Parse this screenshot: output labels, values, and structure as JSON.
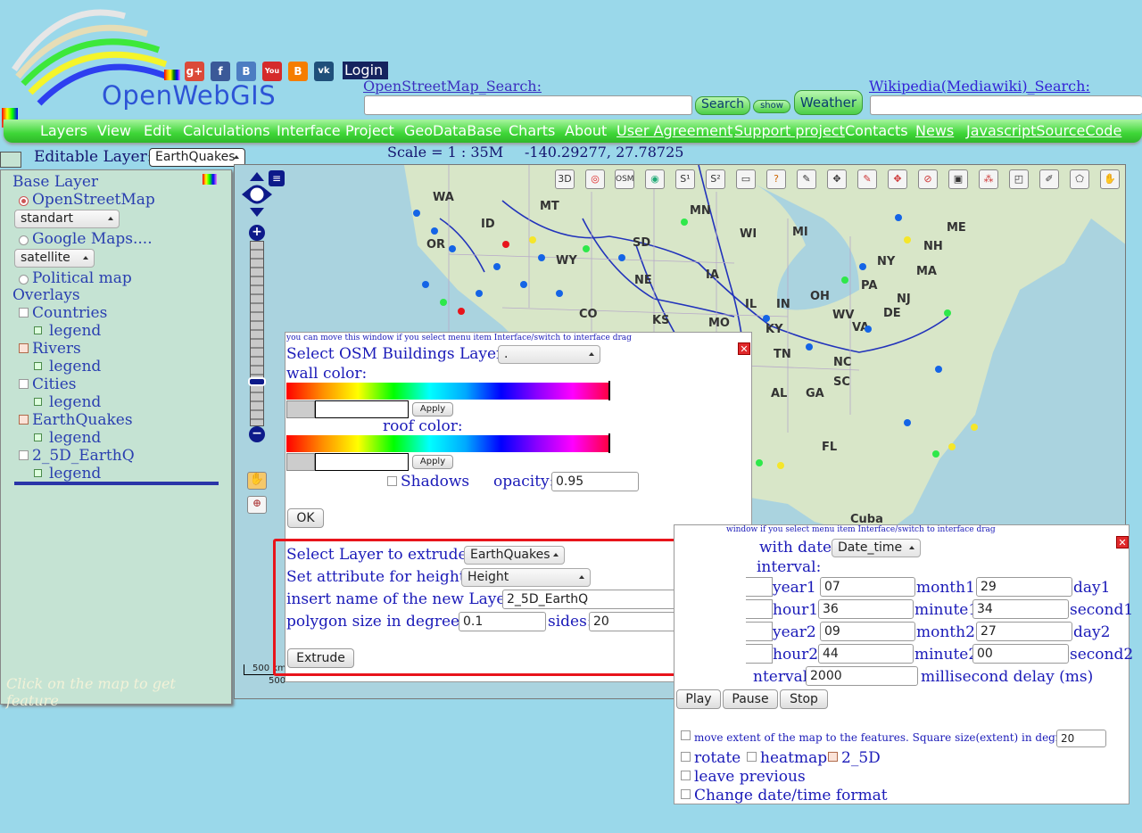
{
  "header": {
    "logo_text": "OpenWebGIS",
    "social_icons": [
      "rainbow-icon",
      "google-plus-icon",
      "facebook-icon",
      "b-icon",
      "youtube-icon",
      "blogger-icon",
      "vk-icon"
    ],
    "social_letters": {
      "google": "g+",
      "facebook": "f",
      "b": "B",
      "youtube": "You",
      "blogger": "B",
      "vk": "vk"
    },
    "login_label": "Login",
    "osm_search_label": "OpenStreetMap_Search:",
    "osm_search_value": "",
    "search_button": "Search",
    "show_button": "show",
    "weather_button": "Weather",
    "wiki_search_label": "Wikipedia(Mediawiki)_Search:"
  },
  "menu": {
    "items": [
      "Layers",
      "View",
      "Edit",
      "Calculations",
      "Interface",
      "Project",
      "GeoDataBase",
      "Charts",
      "About",
      "User Agreement",
      "Support project",
      "Contacts",
      "News",
      "JavascriptSourceCode"
    ]
  },
  "editable_layer": {
    "label": "Editable Layer:",
    "value": "EarthQuakes"
  },
  "scale": {
    "text": "Scale = 1 : 35M",
    "coords": "-140.29277, 27.78725"
  },
  "layers_panel": {
    "base_layer": "Base Layer",
    "osm": "OpenStreetMap",
    "osm_style": "standart",
    "google": "Google Maps....",
    "google_style": "satellite",
    "political": "Political map",
    "overlays": "Overlays",
    "overlay_items": [
      {
        "name": "Countries",
        "checked": false
      },
      {
        "name": "Rivers",
        "checked": true
      },
      {
        "name": "Cities",
        "checked": false
      },
      {
        "name": "EarthQuakes",
        "checked": true
      },
      {
        "name": "2_5D_EarthQ",
        "checked": false
      }
    ],
    "legend": "legend",
    "feature_hint": "Click on the map to get feature"
  },
  "map": {
    "labels": [
      "WA",
      "MT",
      "MN",
      "ID",
      "OR",
      "SD",
      "WI",
      "MI",
      "ME",
      "NY",
      "NH",
      "MA",
      "WY",
      "NE",
      "IA",
      "PA",
      "NJ",
      "CO",
      "KS",
      "MO",
      "IL",
      "IN",
      "OH",
      "WV",
      "DE",
      "VA",
      "KY",
      "TN",
      "NC",
      "SC",
      "AL",
      "GA",
      "FL",
      "Cuba"
    ],
    "scale_bar": "500 km",
    "scale_bar2": "500"
  },
  "osm_dialog": {
    "hint": "you can move this window if you select menu item Interface/switch to interface drag",
    "select_label": "Select OSM Buildings Layer:",
    "select_value": ".",
    "wall_color": "wall color:",
    "roof_color": "roof color:",
    "apply": "Apply",
    "shadows": "Shadows",
    "opacity_label": "opacity:",
    "opacity_value": "0.95",
    "ok": "OK",
    "extrude_layer_label": "Select Layer to extrude:",
    "extrude_layer_value": "EarthQuakes",
    "height_label": "Set attribute for height:",
    "height_value": "Height",
    "new_layer_label": "insert name of the new Layer:",
    "new_layer_value": "2_5D_EarthQ",
    "polygon_label": "polygon size in degrees:",
    "polygon_value": "0.1",
    "sides_label": "sides:",
    "sides_value": "20",
    "extrude_button": "Extrude"
  },
  "time_dialog": {
    "hint": "window if you select menu item Interface/switch to interface drag",
    "with_date": "with date:",
    "date_field": "Date_time",
    "interval": "interval:",
    "year1": "year1",
    "year1_val": "07",
    "month1": "month1",
    "month1_val": "29",
    "day1": "day1",
    "hour1": "hour1",
    "hour1_val": "36",
    "minute1": "minute1",
    "minute1_val": "34",
    "second1": "second1",
    "year2": "year2",
    "year2_val": "09",
    "month2": "month2",
    "month2_val": "27",
    "day2": "day2",
    "hour2": "hour2",
    "hour2_val": "44",
    "minute2": "minute2",
    "minute2_val": "00",
    "second2": "second2",
    "interval_label": "nterval",
    "interval_val": "2000",
    "delay_label": "millisecond delay (ms)",
    "play": "Play",
    "pause": "Pause",
    "stop": "Stop",
    "move_extent": "move extent of the map to the features. Square size(extent) in degrees",
    "extent_val": "20",
    "rotate": "rotate",
    "heatmap": "heatmap",
    "d25": "2_5D",
    "leave_previous": "leave previous",
    "change_format": "Change date/time format"
  },
  "colors": {
    "menu_green": "#3ed637",
    "highlight_red": "#e8141b",
    "dot_blue": "#1464e6",
    "dot_green": "#2ee84a"
  }
}
